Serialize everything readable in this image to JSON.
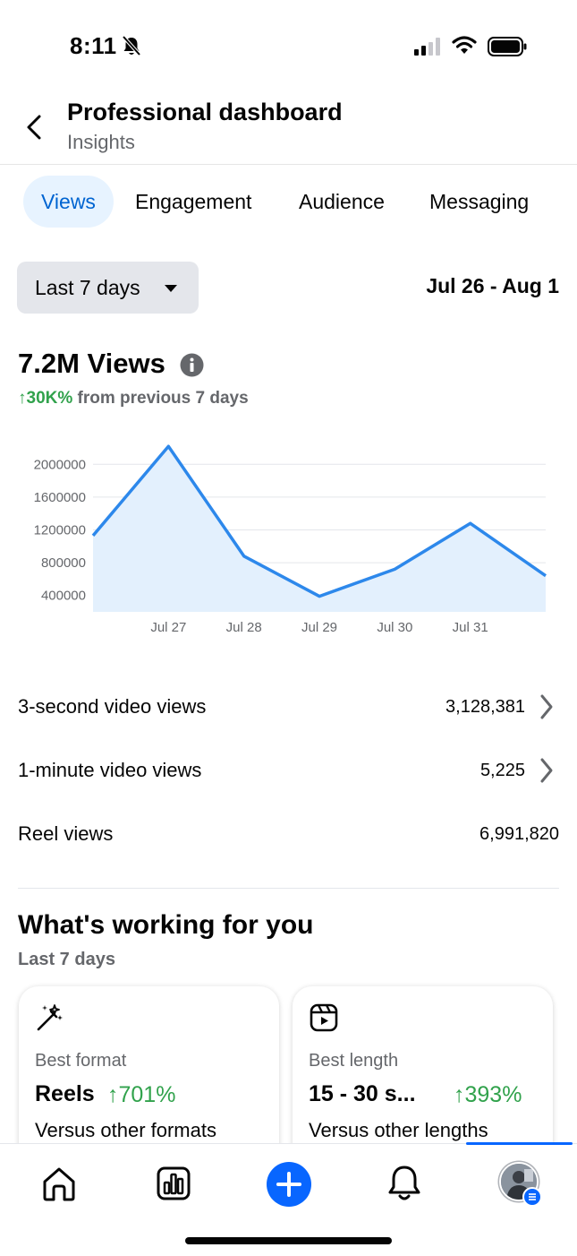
{
  "status_bar": {
    "time": "8:11"
  },
  "header": {
    "title": "Professional dashboard",
    "subtitle": "Insights"
  },
  "tabs": [
    {
      "label": "Views",
      "active": true
    },
    {
      "label": "Engagement",
      "active": false
    },
    {
      "label": "Audience",
      "active": false
    },
    {
      "label": "Messaging",
      "active": false
    }
  ],
  "filter": {
    "range_label": "Last 7 days",
    "date_range": "Jul 26 - Aug 1"
  },
  "metric": {
    "value": "7.2M Views",
    "change": "↑30K%",
    "change_suffix": "from previous 7 days"
  },
  "chart_data": {
    "type": "area",
    "x": [
      "Jul 26",
      "Jul 27",
      "Jul 28",
      "Jul 29",
      "Jul 30",
      "Jul 31",
      "Aug 1"
    ],
    "x_tick_labels": [
      "Jul 27",
      "Jul 28",
      "Jul 29",
      "Jul 30",
      "Jul 31"
    ],
    "y_tick_labels": [
      "2000000",
      "1600000",
      "1200000",
      "800000",
      "400000"
    ],
    "series": [
      {
        "values": [
          1130000,
          2220000,
          880000,
          390000,
          720000,
          1280000,
          640000
        ]
      }
    ],
    "ylim": [
      200000,
      2200000
    ],
    "grid": true,
    "colors": {
      "line": "#2d88eb",
      "fill": "#e3f0fd"
    }
  },
  "stats": [
    {
      "label": "3-second video views",
      "value": "3,128,381",
      "has_chevron": true
    },
    {
      "label": "1-minute video views",
      "value": "5,225",
      "has_chevron": true
    },
    {
      "label": "Reel views",
      "value": "6,991,820",
      "has_chevron": false
    }
  ],
  "working": {
    "title": "What's working for you",
    "subtitle": "Last 7 days",
    "cards": [
      {
        "icon": "magic-wand-icon",
        "label": "Best format",
        "value": "Reels",
        "change": "↑701%",
        "note": "Versus other formats"
      },
      {
        "icon": "reels-icon",
        "label": "Best length",
        "value": "15 - 30 s...",
        "change": "↑393%",
        "note": "Versus other lengths"
      }
    ]
  },
  "bottom_nav": {
    "items": [
      "home-icon",
      "insights-icon",
      "create-icon",
      "notifications-icon",
      "profile-avatar"
    ],
    "active": "profile-avatar"
  },
  "colors": {
    "accent": "#0866ff",
    "positive": "#31a24c",
    "muted": "#65676b"
  }
}
